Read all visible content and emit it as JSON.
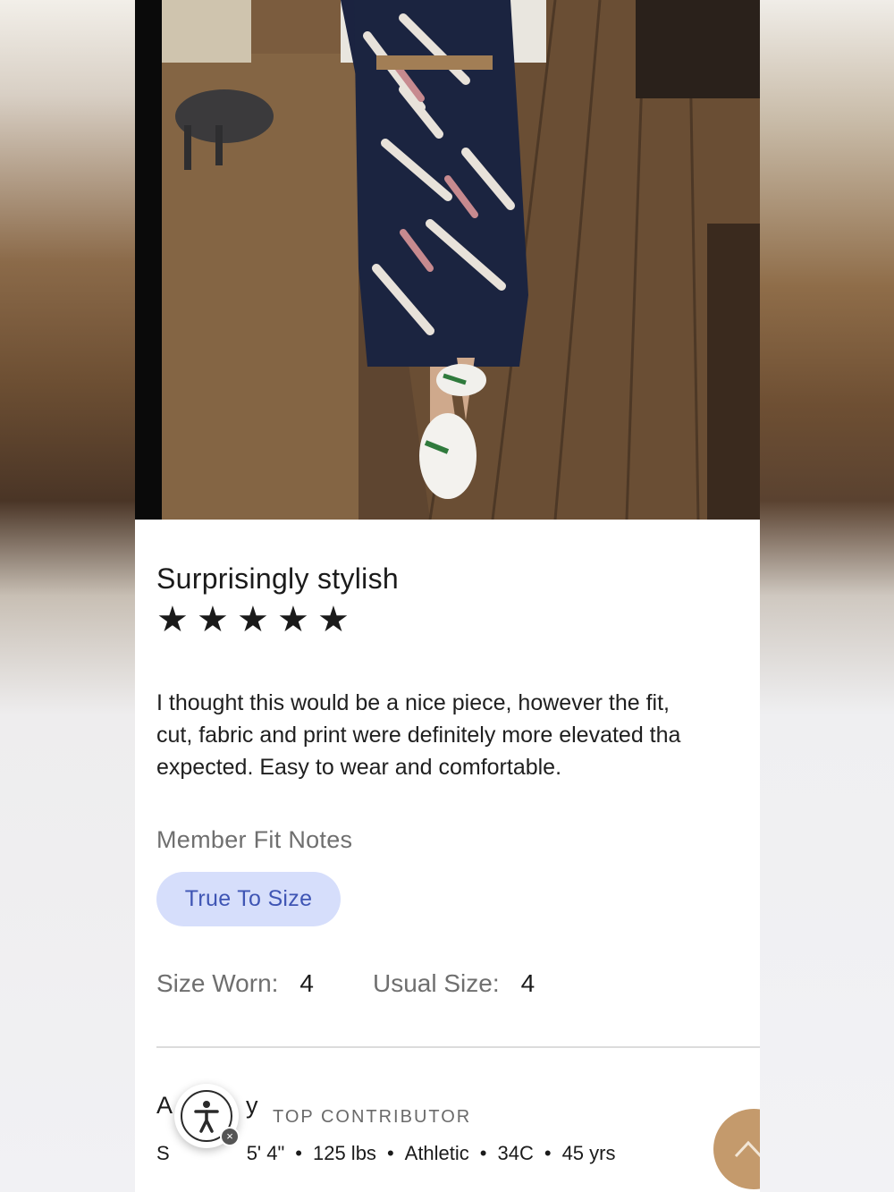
{
  "review": {
    "title": "Surprisingly stylish",
    "rating": 5,
    "stars": [
      "★",
      "★",
      "★",
      "★",
      "★"
    ],
    "body": "I thought this would be a nice piece, however the fit,\ncut, fabric and print were definitely more elevated tha\nexpected. Easy to wear and comfortable."
  },
  "fit_notes": {
    "heading": "Member Fit Notes",
    "pill": "True To Size"
  },
  "sizes": {
    "worn_label": "Size Worn:",
    "worn_value": "4",
    "usual_label": "Usual Size:",
    "usual_value": "4"
  },
  "reviewer": {
    "name_partial": "A",
    "name_partial_end": "y",
    "badge": "TOP CONTRIBUTOR",
    "stats_prefix": "S",
    "height": "5' 4\"",
    "weight": "125 lbs",
    "body_type": "Athletic",
    "bust": "34C",
    "age": "45 yrs"
  },
  "icons": {
    "accessibility": "accessibility-icon",
    "close": "close-icon",
    "scroll_top": "chevron-up-icon"
  },
  "colors": {
    "pill_bg": "#d6defb",
    "pill_text": "#3f55b4",
    "scroll_top_bg": "#c49a6c"
  }
}
